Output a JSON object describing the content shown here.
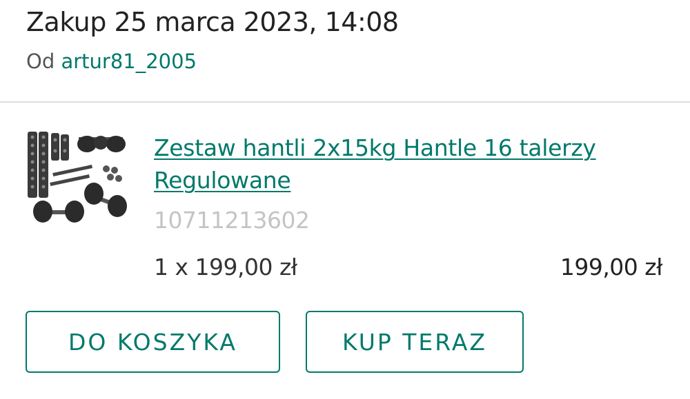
{
  "purchase": {
    "title": "Zakup 25 marca 2023, 14:08",
    "seller_prefix": "Od",
    "seller_name": "artur81_2005"
  },
  "item": {
    "image_icon": "dumbbell-set-image",
    "title": "Zestaw hantli 2x15kg Hantle 16 talerzy Regulowane",
    "offer_id": "10711213602",
    "quantity_price": "1 x 199,00 zł",
    "total_price": "199,00 zł"
  },
  "actions": {
    "add_to_cart": "DO KOSZYKA",
    "buy_now": "KUP TERAZ"
  },
  "colors": {
    "accent": "#00796b",
    "text": "#222222",
    "muted": "#c4c4c4"
  }
}
